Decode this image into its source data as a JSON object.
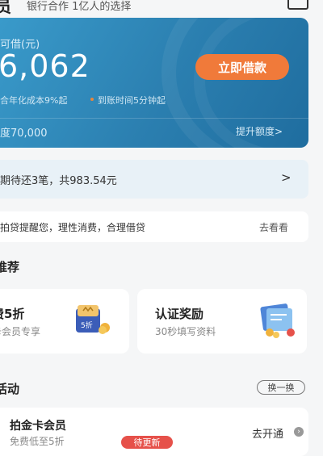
{
  "header": {
    "title": "员",
    "tagline": "银行合作 1亿人的选择",
    "icon": "message-icon"
  },
  "loan_card": {
    "label": "可借(元)",
    "amount": "6,062",
    "note_rate": "合年化成本9%起",
    "note_time": "到账时间5分钟起",
    "borrow_button": "立即借款",
    "limit": "度70,000",
    "raise_link": "提升额度>"
  },
  "repay": {
    "text": "期待还3笔，共983.54元",
    "arrow": ">"
  },
  "reminder": {
    "text": "拍贷提醒您，理性消费，合理借贷",
    "link": "去看看"
  },
  "recommend": {
    "title": "推荐",
    "tiles": [
      {
        "title": "费5折",
        "subtitle": "卡会员专享",
        "badge": "5折",
        "icon": "gift-box-icon"
      },
      {
        "title": "认证奖励",
        "subtitle": "30秒填写资料",
        "icon": "certificate-icon"
      }
    ]
  },
  "activity": {
    "title": "活动",
    "swap_button": "换一换",
    "item": {
      "title": "拍金卡会员",
      "subtitle": "免费低至5折",
      "badge": "待更新",
      "link": "去开通",
      "arrow": "›"
    }
  },
  "colors": {
    "card": "#2b7fb0",
    "accent": "#f07a3a",
    "badge_red": "#e6514a",
    "repay_bg": "#e8f1f7"
  }
}
